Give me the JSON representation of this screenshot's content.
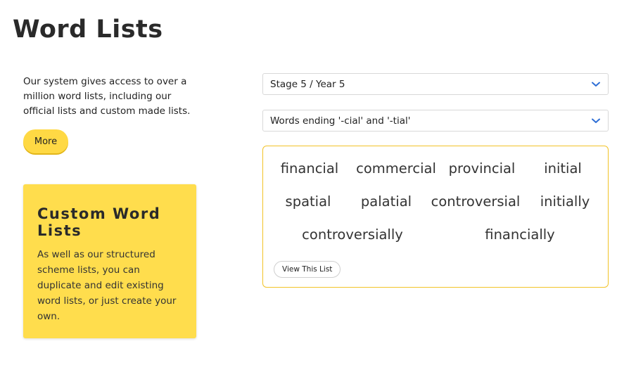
{
  "page": {
    "title": "Word Lists",
    "intro": "Our system gives access to over a million word lists, including our official lists and custom made lists.",
    "more_label": "More"
  },
  "custom_card": {
    "heading": "Custom Word Lists",
    "body": "As well as our structured scheme lists, you can duplicate and edit existing word lists, or just create your own."
  },
  "selects": {
    "stage": "Stage 5 / Year 5",
    "list": "Words ending '-cial' and '-tial'"
  },
  "words": [
    "financial",
    "commercial",
    "provincial",
    "initial",
    "spatial",
    "palatial",
    "controversial",
    "initially",
    "controversially",
    "financially"
  ],
  "view_list_label": "View This List",
  "icons": {
    "dropdown": "chevron-down-icon"
  },
  "colors": {
    "accent_yellow": "#ffd944",
    "card_yellow": "#ffdd4d",
    "box_border": "#f2c327",
    "chevron_blue": "#2f6fd6"
  }
}
